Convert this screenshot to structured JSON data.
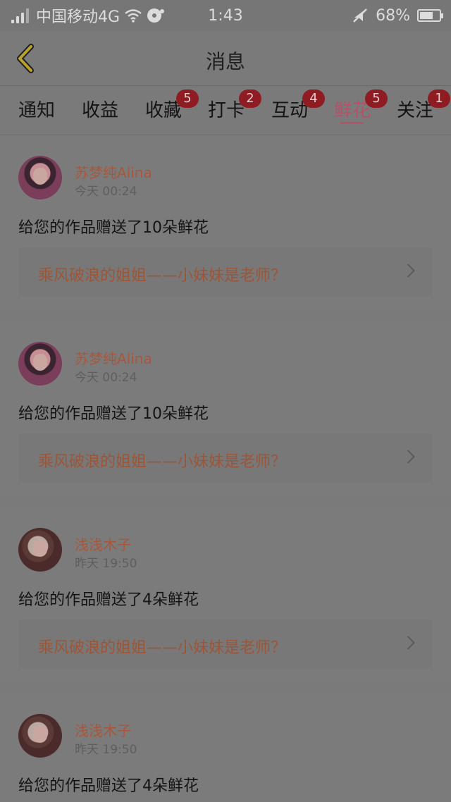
{
  "status_bar": {
    "carrier": "中国移动4G",
    "time": "1:43",
    "battery": "68%",
    "battery_level": 0.68
  },
  "header": {
    "title": "消息"
  },
  "tabs": [
    {
      "label": "通知",
      "badge": null,
      "active": false
    },
    {
      "label": "收益",
      "badge": null,
      "active": false
    },
    {
      "label": "收藏",
      "badge": "5",
      "active": false
    },
    {
      "label": "打卡",
      "badge": "2",
      "active": false
    },
    {
      "label": "互动",
      "badge": "4",
      "active": false
    },
    {
      "label": "鲜花",
      "badge": "5",
      "active": true
    },
    {
      "label": "关注",
      "badge": "1",
      "active": false
    }
  ],
  "feed": [
    {
      "author": "苏梦纯Alina",
      "time": "今天 00:24",
      "message": "给您的作品赠送了10朵鲜花",
      "link": "乘风破浪的姐姐——小妹妹是老师？"
    },
    {
      "author": "苏梦纯Alina",
      "time": "今天 00:24",
      "message": "给您的作品赠送了10朵鲜花",
      "link": "乘风破浪的姐姐——小妹妹是老师？"
    },
    {
      "author": "浅浅木子",
      "time": "昨天 19:50",
      "message": "给您的作品赠送了4朵鲜花",
      "link": "乘风破浪的姐姐——小妹妹是老师？"
    },
    {
      "author": "浅浅木子",
      "time": "昨天 19:50",
      "message": "给您的作品赠送了4朵鲜花",
      "link": ""
    }
  ],
  "colors": {
    "accent": "#b2536a",
    "badge": "#8f1c22",
    "author": "#a8573a",
    "back_icon": "#b8a22a"
  },
  "icons": [
    "signal-icon",
    "wifi-icon",
    "hotspot-icon",
    "mute-icon",
    "battery-icon",
    "back-arrow-icon",
    "chevron-right-icon"
  ]
}
